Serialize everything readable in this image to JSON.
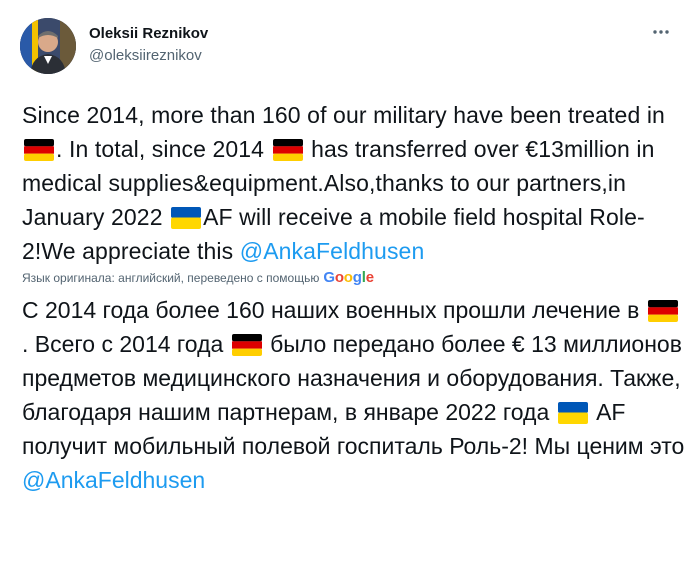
{
  "author": {
    "display_name": "Oleksii Reznikov",
    "handle": "@oleksiireznikov"
  },
  "more_icon": "more-horizontal-icon",
  "tweet": {
    "p1": "Since 2014, more than 160 of our military have been treated in",
    "p2": ". In total, since 2014",
    "p3": "has transferred over €13million in medical supplies&equipment.Also,thanks to our partners,in January 2022",
    "p4": "AF will receive a mobile field hospital Role-2!We appreciate this",
    "mention": "@AnkaFeldhusen"
  },
  "translation_note": {
    "text": "Язык оригинала: английский, переведено с помощью",
    "logo": "Google"
  },
  "translated": {
    "p1": "С 2014 года более 160 наших военных прошли лечение в",
    "p2": ". Всего с 2014 года",
    "p3": "было передано более € 13 миллионов предметов медицинского назначения и оборудования. Также, благодаря нашим партнерам, в январе 2022 года",
    "p4": "AF получит мобильный полевой госпиталь Роль-2! Мы ценим это",
    "mention": "@AnkaFeldhusen"
  },
  "flags": {
    "germany": [
      "#000000",
      "#dd0000",
      "#ffce00"
    ],
    "ukraine": [
      "#0057b7",
      "#ffd700"
    ]
  },
  "colors": {
    "link": "#1d9bf0",
    "secondary": "#536471",
    "text": "#0f1419"
  }
}
